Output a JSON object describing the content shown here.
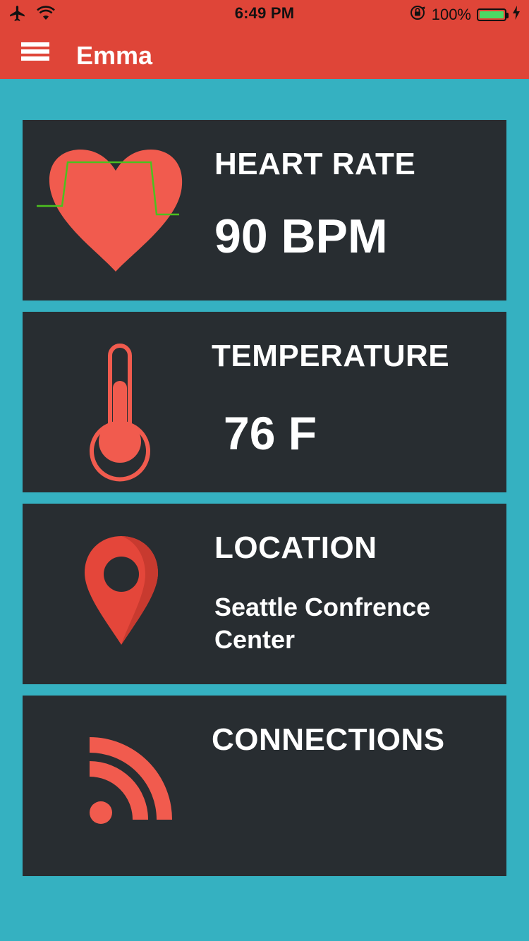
{
  "status_bar": {
    "time": "6:49 PM",
    "battery_percent": "100%",
    "icons": [
      "airplane-icon",
      "wifi-icon",
      "orientation-lock-icon",
      "battery-icon",
      "charging-icon"
    ]
  },
  "nav": {
    "title": "Emma",
    "menu_icon": "hamburger-menu-icon"
  },
  "cards": [
    {
      "title": "HEART RATE",
      "value": "90 BPM",
      "icon": "heart-rate-icon"
    },
    {
      "title": "TEMPERATURE",
      "value": "76 F",
      "icon": "thermometer-icon"
    },
    {
      "title": "LOCATION",
      "value_lines": [
        "Seattle Confrence",
        "Center"
      ],
      "icon": "location-pin-icon"
    },
    {
      "title": "CONNECTIONS",
      "icon": "wireless-signal-icon"
    }
  ],
  "colors": {
    "accent": "#df4538",
    "background": "#35b1c1",
    "card": "#282d31",
    "icon": "#f15b4e",
    "heartbeat_line": "#4cc01f"
  }
}
